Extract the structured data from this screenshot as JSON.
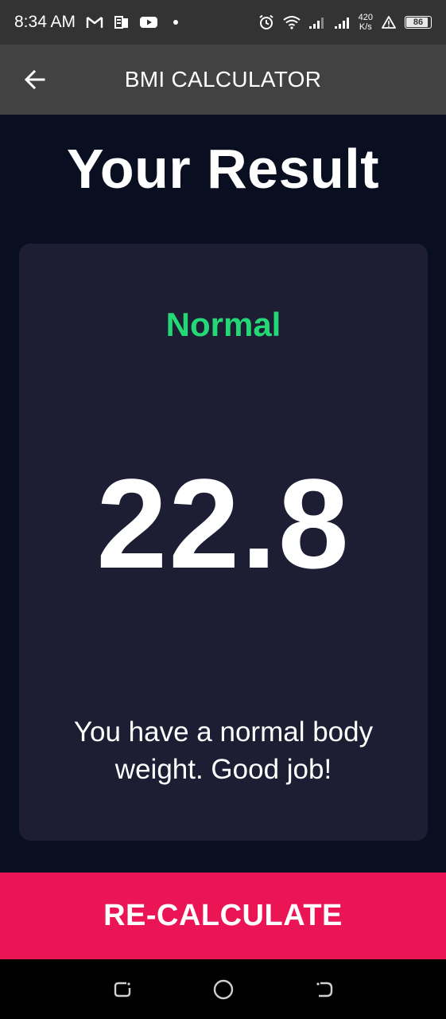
{
  "status_bar": {
    "time": "8:34 AM",
    "net_speed_value": "420",
    "net_speed_unit": "K/s",
    "battery": "86",
    "icons": [
      "gmail-icon",
      "news-icon",
      "youtube-icon",
      "dot-icon",
      "alarm-icon",
      "wifi-icon",
      "signal-icon",
      "signal-icon",
      "alert-icon",
      "battery-icon"
    ]
  },
  "app_bar": {
    "title": "BMI CALCULATOR",
    "back_icon": "arrow-left-icon"
  },
  "page": {
    "title": "Your Result"
  },
  "result": {
    "status": "Normal",
    "bmi": "22.8",
    "message": "You have a normal body weight. Good job!"
  },
  "actions": {
    "recalculate_label": "RE-CALCULATE"
  },
  "nav_bar": {
    "icons": [
      "recent-apps-icon",
      "home-icon",
      "back-nav-icon"
    ]
  },
  "colors": {
    "background": "#0a0e21",
    "card": "#1d1e33",
    "app_bar": "#424242",
    "status_normal": "#24d876",
    "accent": "#eb1555"
  }
}
